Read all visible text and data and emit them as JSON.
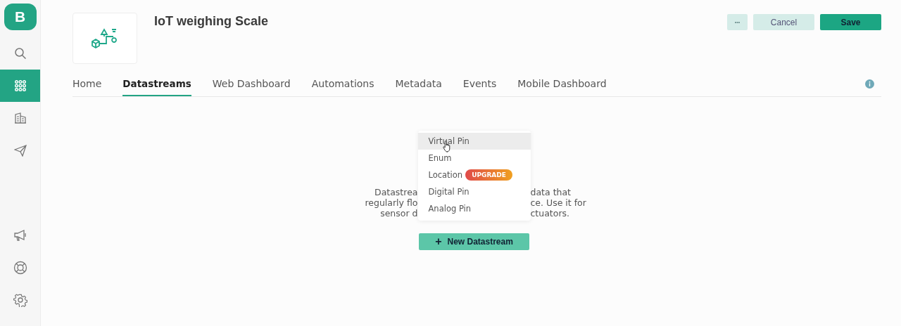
{
  "sidebar": {
    "logo": "B",
    "items": [
      {
        "selected": false
      },
      {
        "selected": true
      },
      {
        "selected": false
      },
      {
        "selected": false
      },
      {
        "selected": false
      },
      {
        "selected": false
      },
      {
        "selected": false
      }
    ]
  },
  "header": {
    "title": "IoT weighing Scale",
    "buttons": [
      {
        "kind": "more",
        "label": "•••"
      },
      {
        "kind": "secondary",
        "label": "Cancel"
      },
      {
        "kind": "primary",
        "label": "Save"
      }
    ]
  },
  "tabs": [
    {
      "label": "Home",
      "selected": false
    },
    {
      "label": "Datastreams",
      "selected": true
    },
    {
      "label": "Web Dashboard",
      "selected": false
    },
    {
      "label": "Automations",
      "selected": false
    },
    {
      "label": "Metadata",
      "selected": false
    },
    {
      "label": "Events",
      "selected": false
    },
    {
      "label": "Mobile Dashboard",
      "selected": false
    }
  ],
  "description_lines": [
    {
      "left": "Datastrea",
      "right": "data that"
    },
    {
      "left": "regularly flo",
      "right": "ce. Use it for"
    },
    {
      "left": "sensor d",
      "right": "ctuators."
    }
  ],
  "menu": {
    "items": [
      {
        "label": "Virtual Pin",
        "hovered": true
      },
      {
        "label": "Enum",
        "hovered": false
      },
      {
        "label": "Location",
        "hovered": false,
        "badge": "UPGRADE"
      },
      {
        "label": "Digital Pin",
        "hovered": false
      },
      {
        "label": "Analog Pin",
        "hovered": false
      }
    ]
  },
  "new_button": {
    "icon": "+",
    "label": "New Datastream"
  }
}
